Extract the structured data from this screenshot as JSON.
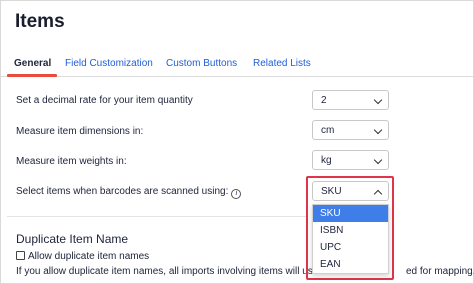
{
  "page": {
    "title": "Items"
  },
  "tabs": [
    {
      "label": "General"
    },
    {
      "label": "Field Customization"
    },
    {
      "label": "Custom Buttons"
    },
    {
      "label": "Related Lists"
    }
  ],
  "settings": {
    "decimal_rate": {
      "label": "Set a decimal rate for your item quantity",
      "value": "2"
    },
    "dimensions": {
      "label": "Measure item dimensions in:",
      "value": "cm"
    },
    "weights": {
      "label": "Measure item weights in:",
      "value": "kg"
    },
    "barcode": {
      "label": "Select items when barcodes are scanned using:",
      "info_icon": "i",
      "value": "SKU",
      "options": [
        "SKU",
        "ISBN",
        "UPC",
        "EAN"
      ]
    }
  },
  "duplicate": {
    "title": "Duplicate Item Name",
    "checkbox_label": "Allow duplicate item names",
    "help_text_start": "If you allow duplicate item names, all imports involving items will use SK",
    "help_text_end": "ed for mapping."
  },
  "icons": {
    "info": "info-circle-icon",
    "chevron": "chevron-down-icon",
    "checkbox": "checkbox-icon"
  },
  "colors": {
    "accent_tab": "#e74c3c",
    "link": "#1f5fd6",
    "highlight": "#e0344a",
    "selected_option": "#3f7ee8"
  }
}
